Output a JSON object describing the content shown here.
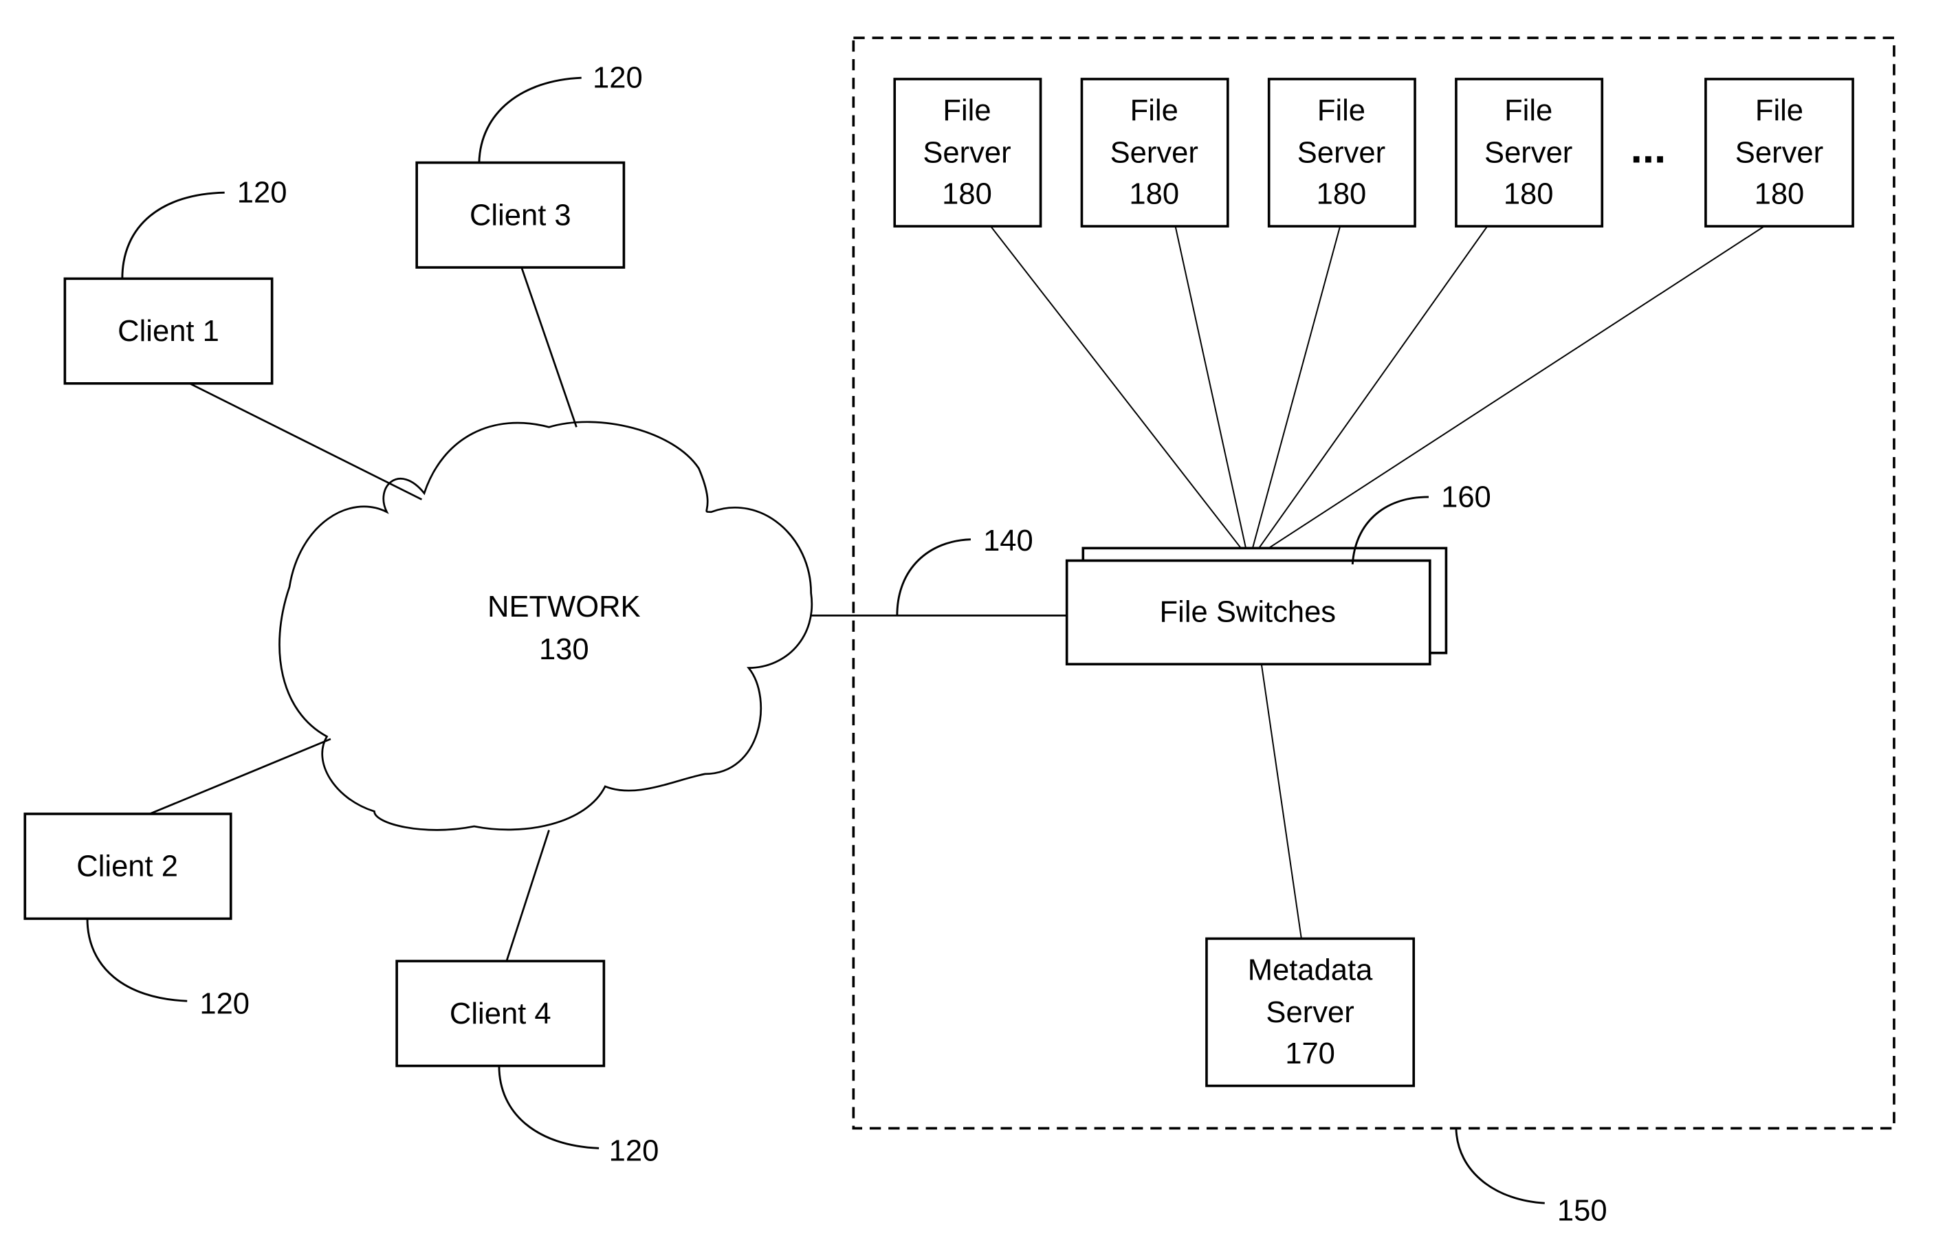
{
  "diagram": {
    "network": {
      "label": "NETWORK",
      "ref": "130"
    },
    "link_ref": "140",
    "cluster_ref": "150",
    "clients": [
      {
        "label": "Client 1",
        "ref": "120"
      },
      {
        "label": "Client 2",
        "ref": "120"
      },
      {
        "label": "Client 3",
        "ref": "120"
      },
      {
        "label": "Client 4",
        "ref": "120"
      }
    ],
    "file_switches": {
      "label": "File Switches",
      "ref": "160"
    },
    "file_servers": [
      {
        "line1": "File",
        "line2": "Server",
        "ref": "180"
      },
      {
        "line1": "File",
        "line2": "Server",
        "ref": "180"
      },
      {
        "line1": "File",
        "line2": "Server",
        "ref": "180"
      },
      {
        "line1": "File",
        "line2": "Server",
        "ref": "180"
      },
      {
        "line1": "File",
        "line2": "Server",
        "ref": "180"
      }
    ],
    "ellipsis": "...",
    "metadata_server": {
      "line1": "Metadata",
      "line2": "Server",
      "ref": "170"
    }
  }
}
